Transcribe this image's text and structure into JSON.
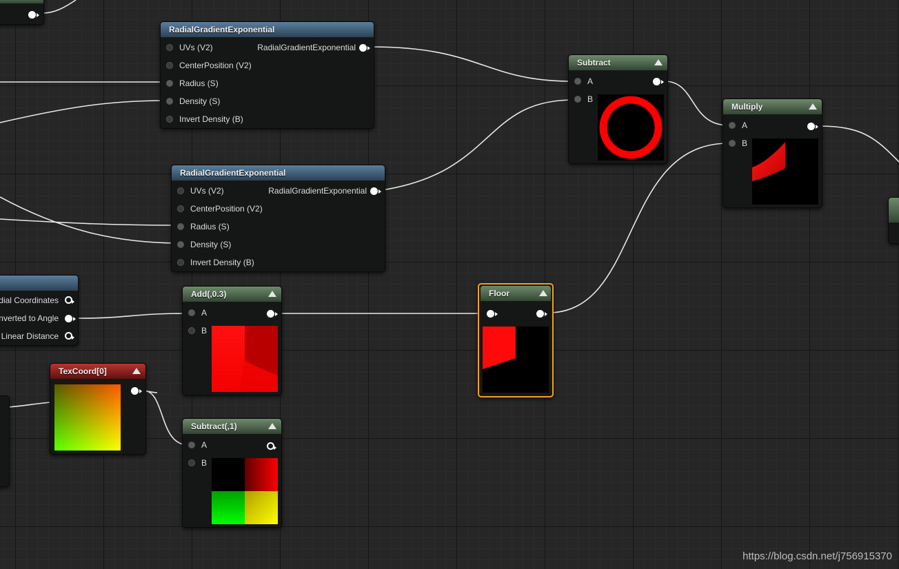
{
  "nodes": {
    "radial1": {
      "title": "RadialGradientExponential",
      "inputs": [
        "UVs (V2)",
        "CenterPosition (V2)",
        "Radius (S)",
        "Density (S)",
        "Invert Density (B)"
      ],
      "output": "RadialGradientExponential"
    },
    "radial2": {
      "title": "RadialGradientExponential",
      "inputs": [
        "UVs (V2)",
        "CenterPosition (V2)",
        "Radius (S)",
        "Density (S)",
        "Invert Density (B)"
      ],
      "output": "RadialGradientExponential"
    },
    "vector_to_radial": {
      "outputs": [
        "dial Coordinates",
        "nverted to Angle",
        "Linear Distance"
      ]
    },
    "subtract": {
      "title": "Subtract",
      "inputs": [
        "A",
        "B"
      ]
    },
    "multiply": {
      "title": "Multiply",
      "inputs": [
        "A",
        "B"
      ]
    },
    "add": {
      "title": "Add(,0.3)",
      "inputs": [
        "A",
        "B"
      ]
    },
    "floor": {
      "title": "Floor"
    },
    "texcoord": {
      "title": "TexCoord[0]"
    },
    "subtract1": {
      "title": "Subtract(,1)",
      "inputs": [
        "A",
        "B"
      ]
    }
  },
  "colors": {
    "selection_outline": "#f2a21a",
    "header_math": "#4d6a4c",
    "header_function": "#3e5a74",
    "header_texcoord": "#8c1f1b",
    "wire": "#e8e8e8"
  },
  "watermark": "https://blog.csdn.net/j756915370"
}
